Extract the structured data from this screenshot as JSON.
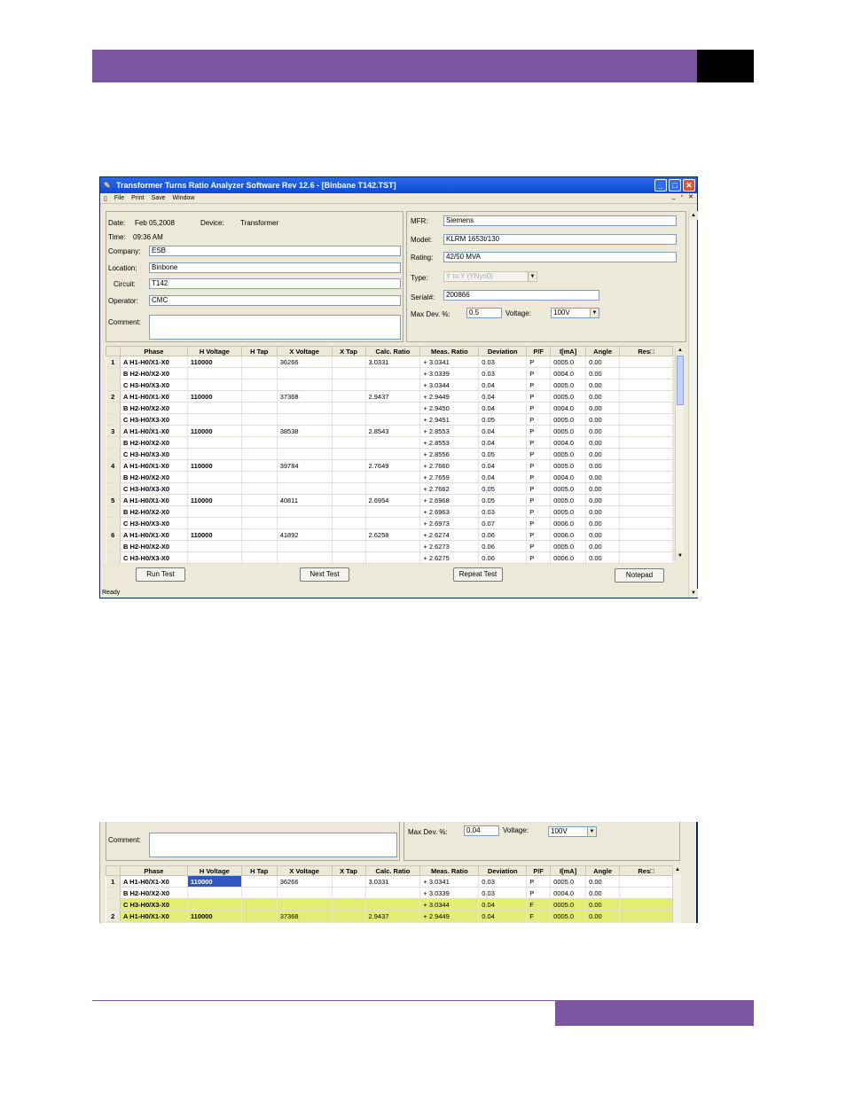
{
  "window": {
    "title": "Transformer Turns Ratio Analyzer Software Rev 12.6 - [Binbane T142.TST]",
    "menu": [
      "File",
      "Print",
      "Save",
      "Window"
    ],
    "mdi_controls": [
      "_",
      "▫",
      "✕"
    ],
    "status": "Ready"
  },
  "form": {
    "date_label": "Date:",
    "date_value": "Feb 05,2008",
    "device_label": "Device:",
    "device_value": "Transformer",
    "time_label": "Time:",
    "time_value": "09:36 AM",
    "company_label": "Company:",
    "company_value": "ESB",
    "location_label": "Location:",
    "location_value": "Binbone",
    "circuit_label": "Circuit:",
    "circuit_value": "T142",
    "operator_label": "Operator:",
    "operator_value": "CMC",
    "comment_label": "Comment:",
    "mfr_label": "MFR:",
    "mfr_value": "Siemens",
    "model_label": "Model:",
    "model_value": "KLRM 1653t/130",
    "rating_label": "Rating:",
    "rating_value": "42/50 MVA",
    "type_label": "Type:",
    "type_value": "Y to Y (YNyn0)",
    "serial_label": "Serial#:",
    "serial_value": "200866",
    "maxdev_label": "Max Dev. %:",
    "maxdev_value": "0.5",
    "voltage_label": "Voltage:",
    "voltage_value": "100V"
  },
  "table": {
    "headers": [
      "",
      "Phase",
      "H Voltage",
      "H Tap",
      "X Voltage",
      "X Tap",
      "Calc. Ratio",
      "Meas. Ratio",
      "Deviation",
      "P/F",
      "I[mA]",
      "Angle",
      "Res□"
    ],
    "rows": [
      [
        "1",
        "A  H1-H0/X1-X0",
        "110000",
        "",
        "36266",
        "",
        "3.0331",
        "+ 3.0341",
        "0.03",
        "P",
        "0005.0",
        "0.00",
        ""
      ],
      [
        "",
        "B  H2-H0/X2-X0",
        "",
        "",
        "",
        "",
        "",
        "+ 3.0339",
        "0.03",
        "P",
        "0004.0",
        "0.00",
        ""
      ],
      [
        "",
        "C  H3-H0/X3-X0",
        "",
        "",
        "",
        "",
        "",
        "+ 3.0344",
        "0.04",
        "P",
        "0005.0",
        "0.00",
        ""
      ],
      [
        "2",
        "A  H1-H0/X1-X0",
        "110000",
        "",
        "37368",
        "",
        "2.9437",
        "+ 2.9449",
        "0.04",
        "P",
        "0005.0",
        "0.00",
        ""
      ],
      [
        "",
        "B  H2-H0/X2-X0",
        "",
        "",
        "",
        "",
        "",
        "+ 2.9450",
        "0.04",
        "P",
        "0004.0",
        "0.00",
        ""
      ],
      [
        "",
        "C  H3-H0/X3-X0",
        "",
        "",
        "",
        "",
        "",
        "+ 2.9451",
        "0.05",
        "P",
        "0005.0",
        "0.00",
        ""
      ],
      [
        "3",
        "A  H1-H0/X1-X0",
        "110000",
        "",
        "38538",
        "",
        "2.8543",
        "+ 2.8553",
        "0.04",
        "P",
        "0005.0",
        "0.00",
        ""
      ],
      [
        "",
        "B  H2-H0/X2-X0",
        "",
        "",
        "",
        "",
        "",
        "+ 2.8553",
        "0.04",
        "P",
        "0004.0",
        "0.00",
        ""
      ],
      [
        "",
        "C  H3-H0/X3-X0",
        "",
        "",
        "",
        "",
        "",
        "+ 2.8556",
        "0.05",
        "P",
        "0005.0",
        "0.00",
        ""
      ],
      [
        "4",
        "A  H1-H0/X1-X0",
        "110000",
        "",
        "39784",
        "",
        "2.7649",
        "+ 2.7660",
        "0.04",
        "P",
        "0005.0",
        "0.00",
        ""
      ],
      [
        "",
        "B  H2-H0/X2-X0",
        "",
        "",
        "",
        "",
        "",
        "+ 2.7659",
        "0.04",
        "P",
        "0004.0",
        "0.00",
        ""
      ],
      [
        "",
        "C  H3-H0/X3-X0",
        "",
        "",
        "",
        "",
        "",
        "+ 2.7662",
        "0.05",
        "P",
        "0005.0",
        "0.00",
        ""
      ],
      [
        "5",
        "A  H1-H0/X1-X0",
        "110000",
        "",
        "40811",
        "",
        "2.6954",
        "+ 2.6968",
        "0.05",
        "P",
        "0005.0",
        "0.00",
        ""
      ],
      [
        "",
        "B  H2-H0/X2-X0",
        "",
        "",
        "",
        "",
        "",
        "+ 2.6963",
        "0.03",
        "P",
        "0005.0",
        "0.00",
        ""
      ],
      [
        "",
        "C  H3-H0/X3-X0",
        "",
        "",
        "",
        "",
        "",
        "+ 2.6973",
        "0.07",
        "P",
        "0006.0",
        "0.00",
        ""
      ],
      [
        "6",
        "A  H1-H0/X1-X0",
        "110000",
        "",
        "41892",
        "",
        "2.6258",
        "+ 2.6274",
        "0.06",
        "P",
        "0006.0",
        "0.00",
        ""
      ],
      [
        "",
        "B  H2-H0/X2-X0",
        "",
        "",
        "",
        "",
        "",
        "+ 2.6273",
        "0.06",
        "P",
        "0005.0",
        "0.00",
        ""
      ],
      [
        "",
        "C  H3-H0/X3-X0",
        "",
        "",
        "",
        "",
        "",
        "+ 2.6275",
        "0.06",
        "P",
        "0006.0",
        "0.00",
        ""
      ]
    ]
  },
  "buttons": {
    "run_test": "Run Test",
    "next_test": "Next Test",
    "repeat_test": "Repeat Test",
    "notepad": "Notepad"
  },
  "crop": {
    "comment_label": "Comment:",
    "maxdev_label": "Max Dev. %:",
    "maxdev_value": "0.04",
    "voltage_label": "Voltage:",
    "voltage_value": "100V",
    "rows": [
      [
        "1",
        "A  H1-H0/X1-X0",
        "110000",
        "",
        "36266",
        "",
        "3.0331",
        "+ 3.0341",
        "0.03",
        "P",
        "0005.0",
        "0.00",
        ""
      ],
      [
        "",
        "B  H2-H0/X2-X0",
        "",
        "",
        "",
        "",
        "",
        "+ 3.0339",
        "0.03",
        "P",
        "0004.0",
        "0.00",
        ""
      ],
      [
        "",
        "C  H3-H0/X3-X0",
        "",
        "",
        "",
        "",
        "",
        "+ 3.0344",
        "0.04",
        "F",
        "0005.0",
        "0.00",
        ""
      ],
      [
        "2",
        "A  H1-H0/X1-X0",
        "110000",
        "",
        "37368",
        "",
        "2.9437",
        "+ 2.9449",
        "0.04",
        "F",
        "0005.0",
        "0.00",
        ""
      ]
    ]
  },
  "colors": {
    "header_purple": "#7b55a0",
    "title_blue": "#0b4bd1",
    "fail_yellow": "#e4ec74",
    "selected_blue": "#3156c4"
  }
}
